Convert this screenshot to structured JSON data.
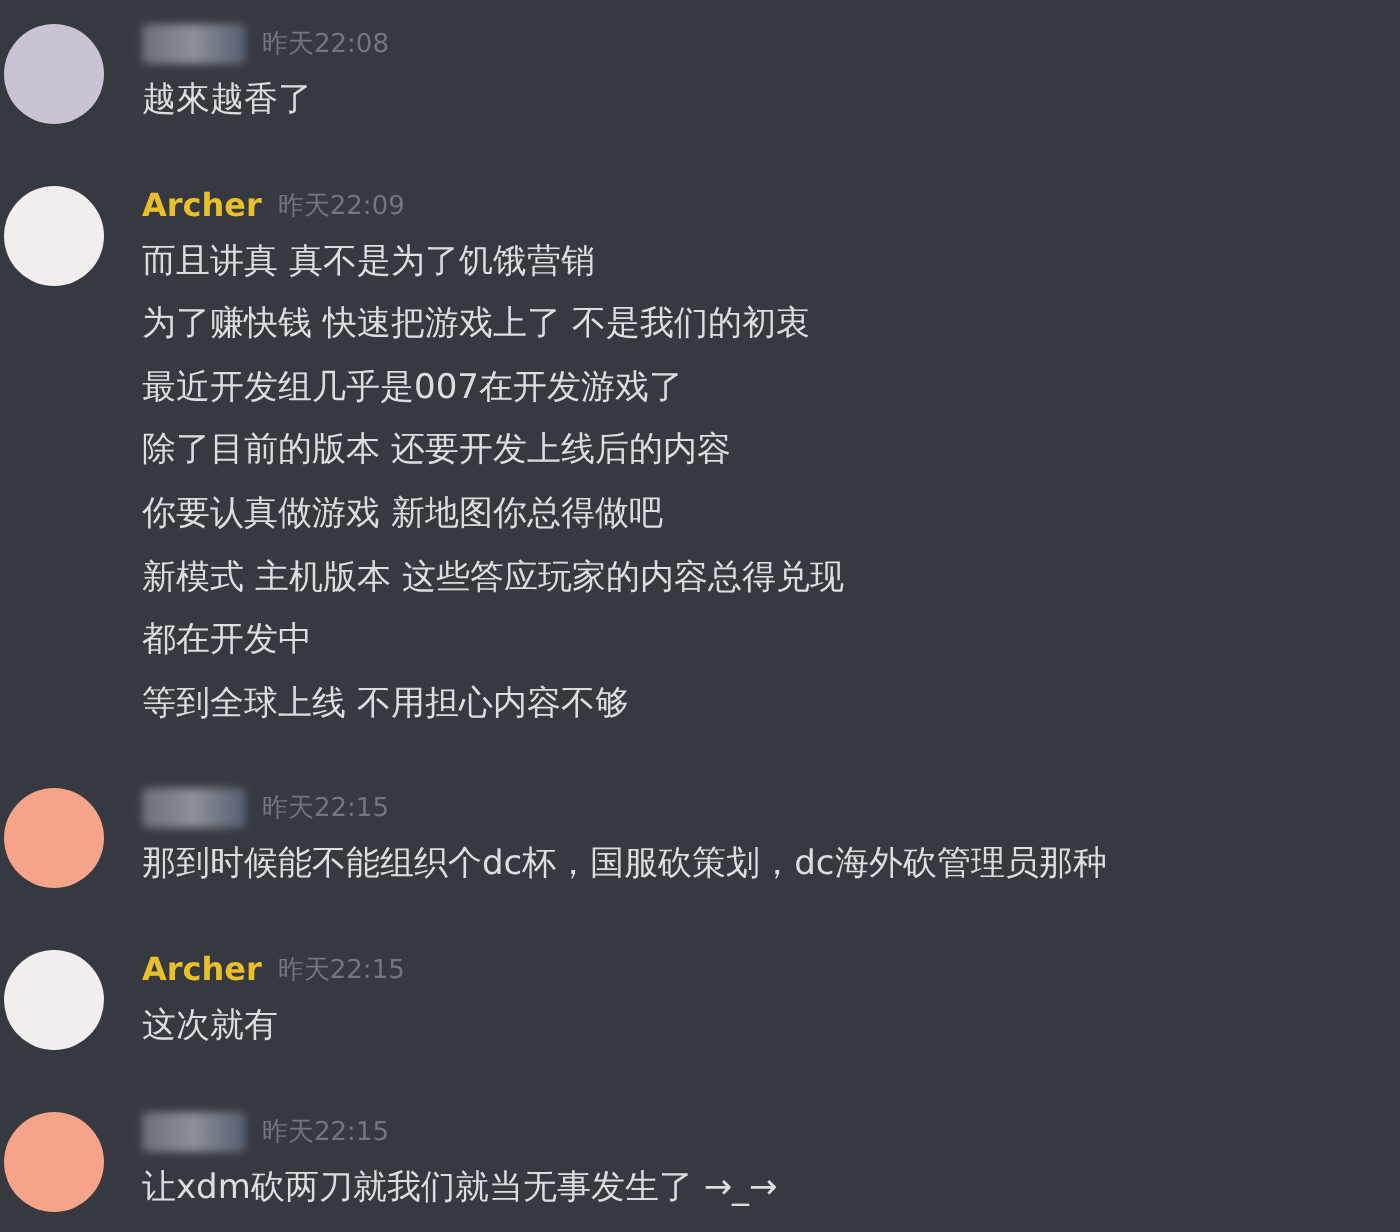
{
  "messages": [
    {
      "author": {
        "redacted": true
      },
      "avatar": {
        "color": "#c9c3d3"
      },
      "time": "昨天22:08",
      "lines": [
        "越來越香了"
      ]
    },
    {
      "author": {
        "redacted": false,
        "name": "Archer",
        "color": "#e9c02a"
      },
      "avatar": {
        "color": "#f2eeee"
      },
      "time": "昨天22:09",
      "lines": [
        "而且讲真 真不是为了饥饿营销",
        "为了赚快钱 快速把游戏上了 不是我们的初衷",
        "最近开发组几乎是007在开发游戏了",
        "除了目前的版本 还要开发上线后的内容",
        "你要认真做游戏 新地图你总得做吧",
        "新模式 主机版本 这些答应玩家的内容总得兑现",
        "都在开发中",
        "等到全球上线 不用担心内容不够"
      ]
    },
    {
      "author": {
        "redacted": true
      },
      "avatar": {
        "color": "#f5a48a"
      },
      "time": "昨天22:15",
      "lines": [
        "那到时候能不能组织个dc杯，国服砍策划，dc海外砍管理员那种"
      ]
    },
    {
      "author": {
        "redacted": false,
        "name": "Archer",
        "color": "#e9c02a"
      },
      "avatar": {
        "color": "#f2eeee"
      },
      "time": "昨天22:15",
      "lines": [
        "这次就有"
      ]
    },
    {
      "author": {
        "redacted": true
      },
      "avatar": {
        "color": "#f5a48a"
      },
      "time": "昨天22:15",
      "lines": [
        "让xdm砍两刀就我们就当无事发生了 →_→"
      ]
    }
  ]
}
